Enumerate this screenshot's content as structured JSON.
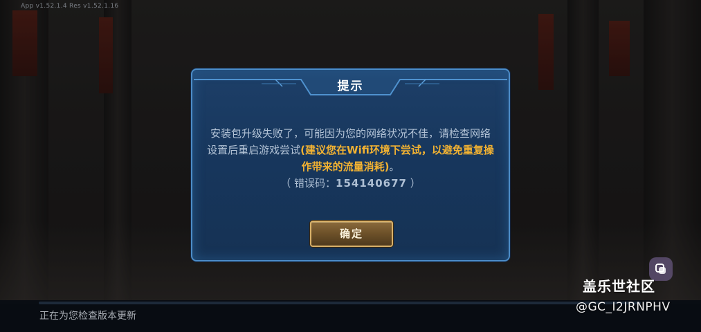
{
  "version_info": "App v1.52.1.4 Res v1.52.1.16",
  "dialog": {
    "title": "提示",
    "message_part1": "安装包升级失败了，可能因为您的网络状况不佳，请检查网络设置后重启游戏尝试",
    "message_highlight": "(建议您在Wifi环境下尝试，以避免重复操作带来的流量消耗)",
    "message_end": "。",
    "error_label": "（ 错误码：",
    "error_code": "154140677",
    "error_close": " ）",
    "confirm_button": "确定"
  },
  "loading": {
    "status_text": "正在为您检查版本更新"
  },
  "watermark": {
    "community": "盖乐世社区",
    "user": "@GC_I2JRNPHV"
  },
  "colors": {
    "dialog_bg": "#1b3a60",
    "dialog_border": "#4c8cc7",
    "highlight": "#f2b232",
    "button_border": "#d8b068"
  }
}
